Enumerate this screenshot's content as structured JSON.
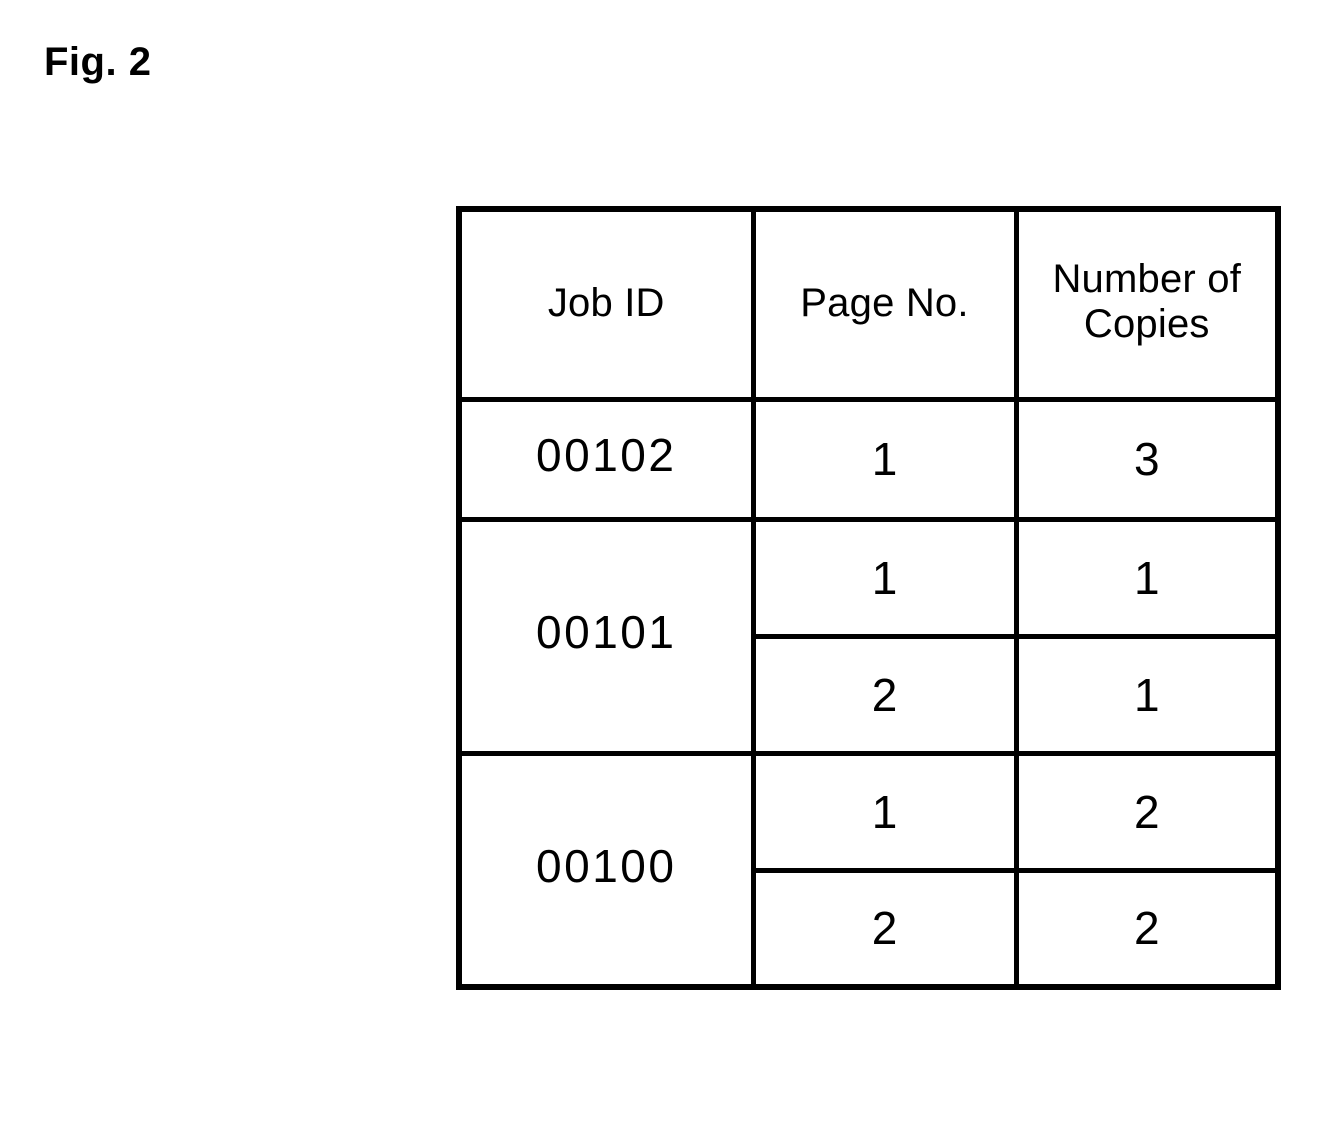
{
  "figure": {
    "label": "Fig. 2"
  },
  "table": {
    "name": "print-job-table",
    "headers": {
      "job_id": "Job ID",
      "page_no": "Page No.",
      "number_of_copies_line1": "Number of",
      "number_of_copies_line2": "Copies"
    },
    "jobs": [
      {
        "job_id": "00102",
        "pages": [
          {
            "page_no": "1",
            "copies": "3"
          }
        ]
      },
      {
        "job_id": "00101",
        "pages": [
          {
            "page_no": "1",
            "copies": "1"
          },
          {
            "page_no": "2",
            "copies": "1"
          }
        ]
      },
      {
        "job_id": "00100",
        "pages": [
          {
            "page_no": "1",
            "copies": "2"
          },
          {
            "page_no": "2",
            "copies": "2"
          }
        ]
      }
    ]
  },
  "colors": {
    "ink": "#000000",
    "paper": "#ffffff"
  }
}
